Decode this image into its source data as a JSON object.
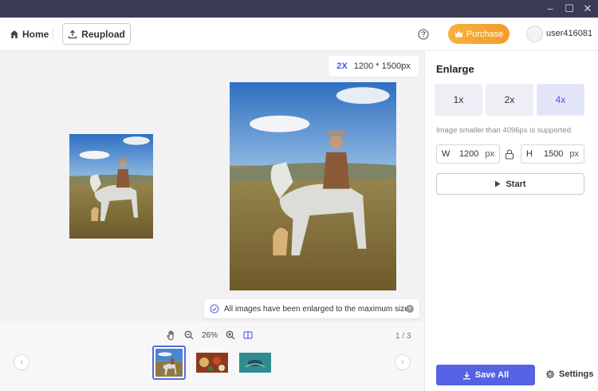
{
  "window": {
    "minimize": "–",
    "maximize": "☐",
    "close": "✕"
  },
  "toolbar": {
    "home_label": "Home",
    "reupload_label": "Reupload",
    "purchase_label": "Purchase",
    "username": "user416081"
  },
  "canvas": {
    "zoom_scale": "2X",
    "zoom_dimensions": "1200 * 1500px",
    "toast_message": "All images have been enlarged to the maximum size.",
    "toast_close": "×"
  },
  "strip": {
    "zoom_percent": "26%",
    "page_count": "1 / 3",
    "prev_arrow": "‹",
    "next_arrow": "›"
  },
  "panel": {
    "title": "Enlarge",
    "scales": [
      {
        "label": "1x",
        "active": false
      },
      {
        "label": "2x",
        "active": false
      },
      {
        "label": "4x",
        "active": true
      }
    ],
    "note": "Image smaller than 4096px is supported",
    "width": {
      "label": "W",
      "value": "1200",
      "unit": "px"
    },
    "height": {
      "label": "H",
      "value": "1500",
      "unit": "px"
    },
    "start_label": "Start",
    "save_all_label": "Save All",
    "settings_label": "Settings"
  },
  "colors": {
    "accent": "#5562e3",
    "purchase": "#f39a2b",
    "titlebar": "#3b3a55"
  }
}
